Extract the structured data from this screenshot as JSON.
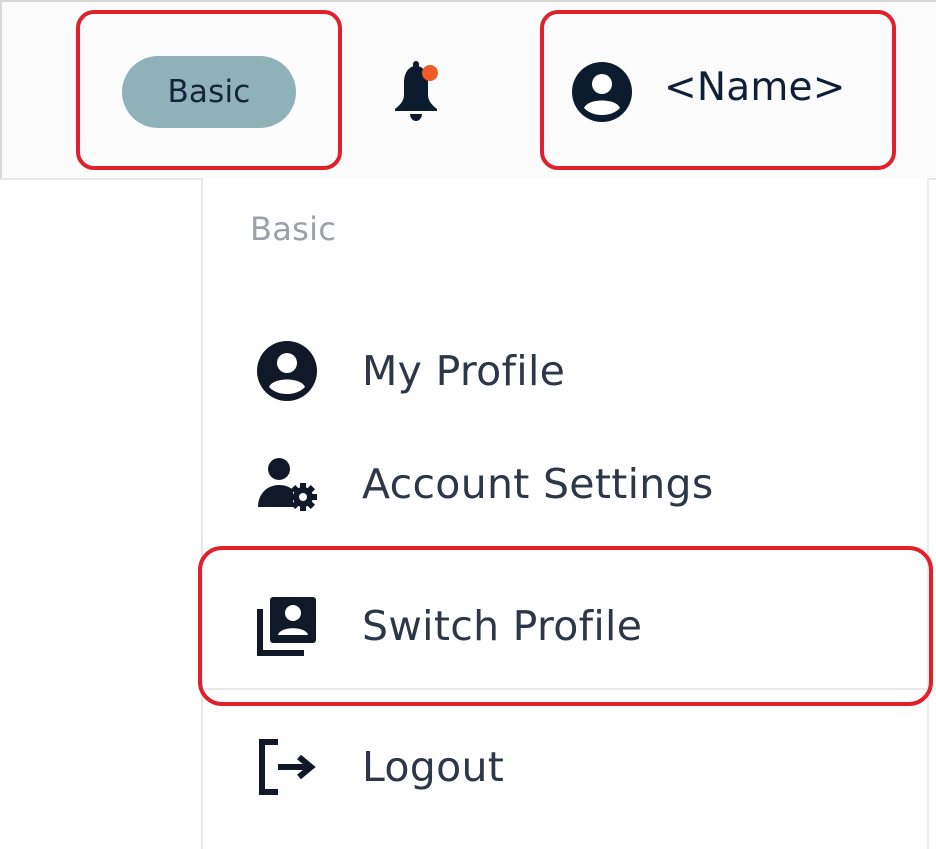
{
  "topbar": {
    "plan_badge": "Basic",
    "user_name": "<Name>",
    "icons": {
      "notifications": "bell-icon",
      "user": "user-circle-icon"
    },
    "colors": {
      "plan_badge_bg": "#8fb2b8",
      "plan_badge_text": "#16243a",
      "notification_dot": "#f05a28",
      "text_dark": "#0f1f36",
      "highlight": "#e0202a"
    }
  },
  "dropdown": {
    "section_label": "Basic",
    "items": [
      {
        "label": "My Profile",
        "icon": "user-circle-icon"
      },
      {
        "label": "Account Settings",
        "icon": "user-gear-icon"
      },
      {
        "label": "Switch Profile",
        "icon": "switch-profile-icon"
      },
      {
        "label": "Logout",
        "icon": "logout-icon"
      }
    ]
  }
}
